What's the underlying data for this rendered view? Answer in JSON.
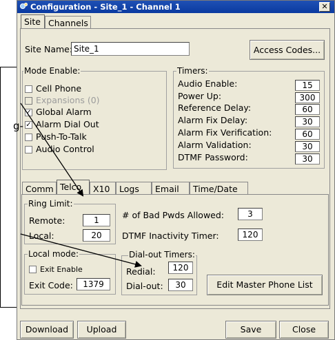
{
  "window": {
    "title": "Configuration - Site_1 - Channel  1",
    "close_glyph": "✕"
  },
  "top_tabs": [
    {
      "label": "Site",
      "active": true
    },
    {
      "label": "Channels",
      "active": false
    }
  ],
  "site": {
    "name_label": "Site Name:",
    "name_value": "Site_1",
    "access_codes_label": "Access Codes..."
  },
  "mode_enable": {
    "title": "Mode Enable:",
    "items": [
      {
        "label": "Cell Phone",
        "checked": false,
        "enabled": true
      },
      {
        "label": "Expansions (0)",
        "checked": false,
        "enabled": false
      },
      {
        "label": "Global Alarm",
        "checked": true,
        "enabled": true
      },
      {
        "label": "Alarm Dial Out",
        "checked": true,
        "enabled": true
      },
      {
        "label": "Push-To-Talk",
        "checked": false,
        "enabled": true
      },
      {
        "label": "Audio Control",
        "checked": false,
        "enabled": true
      }
    ]
  },
  "timers": {
    "title": "Timers:",
    "rows": [
      {
        "label": "Audio Enable:",
        "value": "15"
      },
      {
        "label": "Power Up:",
        "value": "300"
      },
      {
        "label": "Reference Delay:",
        "value": "60"
      },
      {
        "label": "Alarm Fix Delay:",
        "value": "30"
      },
      {
        "label": "Alarm Fix Verification:",
        "value": "60"
      },
      {
        "label": "Alarm Validation:",
        "value": "30"
      },
      {
        "label": "DTMF Password:",
        "value": "30"
      }
    ]
  },
  "sub_tabs": [
    {
      "label": "Comm",
      "active": false
    },
    {
      "label": "Telco",
      "active": true
    },
    {
      "label": "X10",
      "active": false
    },
    {
      "label": "Logs",
      "active": false
    },
    {
      "label": "Email",
      "active": false
    },
    {
      "label": "Time/Date",
      "active": false
    }
  ],
  "ring_limit": {
    "title": "Ring Limit:",
    "remote_label": "Remote:",
    "remote_value": "1",
    "local_label": "Local:",
    "local_value": "20"
  },
  "telco": {
    "bad_pwds_label": "# of Bad Pwds Allowed:",
    "bad_pwds_value": "3",
    "dtmf_label": "DTMF Inactivity Timer:",
    "dtmf_value": "120"
  },
  "local_mode": {
    "title": "Local mode:",
    "exit_enable_label": "Exit Enable",
    "exit_enable_checked": false,
    "exit_code_label": "Exit Code:",
    "exit_code_value": "1379"
  },
  "dialout_timers": {
    "title": "Dial-out Timers:",
    "redial_label": "Redial:",
    "redial_value": "120",
    "dialout_label": "Dial-out:",
    "dialout_value": "30"
  },
  "edit_master_label": "Edit Master Phone List",
  "bottom": {
    "download": "Download",
    "upload": "Upload",
    "save": "Save",
    "close": "Close"
  },
  "callout_text": "g-"
}
